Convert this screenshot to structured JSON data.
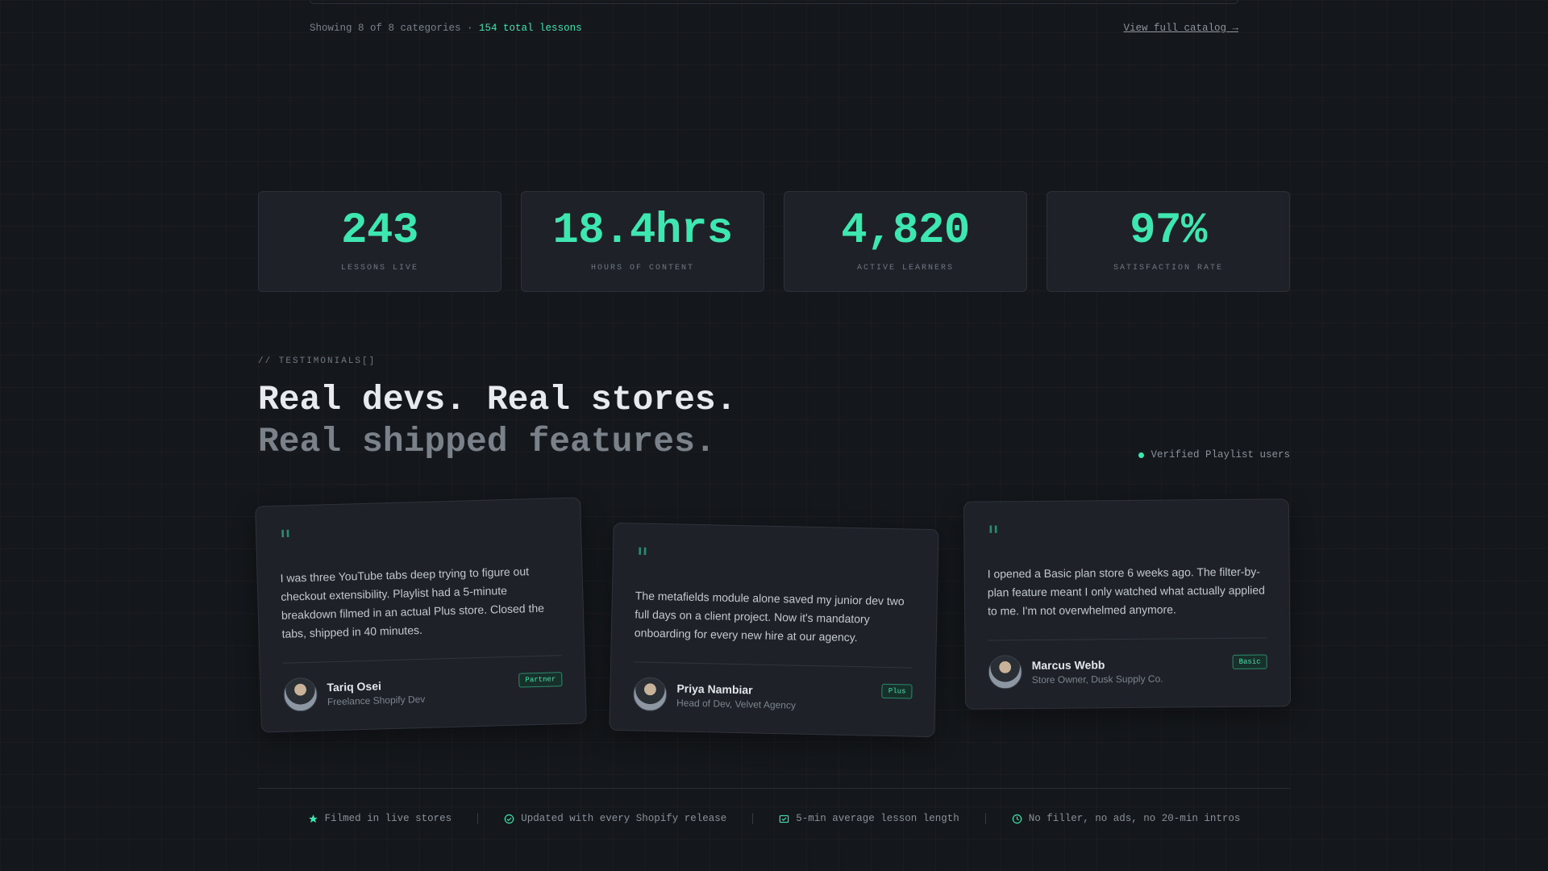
{
  "catalog": {
    "summary_prefix": "Showing 8 of 8 categories · ",
    "total_lessons": "154 total lessons",
    "view_full_catalog": "View full catalog →"
  },
  "stats": [
    {
      "value": "243",
      "label": "LESSONS LIVE"
    },
    {
      "value": "18.4hrs",
      "label": "HOURS OF CONTENT"
    },
    {
      "value": "4,820",
      "label": "ACTIVE LEARNERS"
    },
    {
      "value": "97%",
      "label": "SATISFACTION RATE"
    }
  ],
  "testimonials": {
    "eyebrow": "// TESTIMONIALS[]",
    "headline_line1": "Real devs. Real stores.",
    "headline_line2": "Real shipped features.",
    "verified": "Verified Playlist users",
    "quote_mark": "\"",
    "cards": [
      {
        "quote": "I was three YouTube tabs deep trying to figure out checkout extensibility. Playlist had a 5-minute breakdown filmed in an actual Plus store. Closed the tabs, shipped in 40 minutes.",
        "name": "Tariq Osei",
        "role": "Freelance Shopify Dev",
        "tier": "Partner"
      },
      {
        "quote": "The metafields module alone saved my junior dev two full days on a client project. Now it's mandatory onboarding for every new hire at our agency.",
        "name": "Priya Nambiar",
        "role": "Head of Dev, Velvet Agency",
        "tier": "Plus"
      },
      {
        "quote": "I opened a Basic plan store 6 weeks ago. The filter-by-plan feature meant I only watched what actually applied to me. I'm not overwhelmed anymore.",
        "name": "Marcus Webb",
        "role": "Store Owner, Dusk Supply Co.",
        "tier": "Basic"
      }
    ]
  },
  "features": [
    {
      "icon": "star-icon",
      "text": "Filmed in live stores"
    },
    {
      "icon": "check-circle-icon",
      "text": "Updated with every Shopify release"
    },
    {
      "icon": "video-check-icon",
      "text": "5-min average lesson length"
    },
    {
      "icon": "clock-icon",
      "text": "No filler, no ads, no 20-min intros"
    }
  ],
  "colors": {
    "background": "#14171b",
    "card": "#1e2228",
    "accent": "#3ee6b0"
  }
}
